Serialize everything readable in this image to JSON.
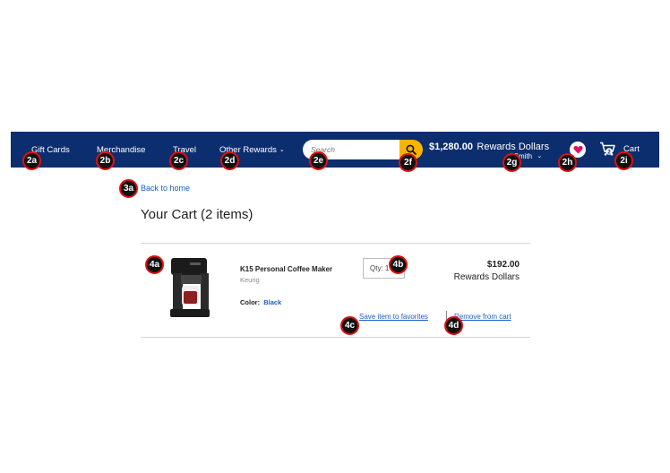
{
  "nav": {
    "items": [
      {
        "label": "Gift Cards"
      },
      {
        "label": "Merchandise"
      },
      {
        "label": "Travel"
      },
      {
        "label": "Other Rewards"
      }
    ],
    "search_placeholder": "Search",
    "rewards_amount": "$1,280.00",
    "rewards_label": "Rewards Dollars",
    "user_name": "d Smith",
    "cart_label": "Cart",
    "cart_count": "2"
  },
  "content": {
    "back_link": "Back to home",
    "title": "Your Cart (2 items)"
  },
  "cart_item": {
    "name": "K15 Personal Coffee Maker",
    "brand": "Keurig",
    "color_label": "Color:",
    "color_value": "Black",
    "qty_label": "Qty:",
    "qty_value": "1",
    "price": "$192.00",
    "price_unit": "Rewards Dollars",
    "save_link": "Save item to favorites",
    "remove_link": "Remove from cart"
  },
  "markers": {
    "m2a": "2a",
    "m2b": "2b",
    "m2c": "2c",
    "m2d": "2d",
    "m2e": "2e",
    "m2f": "2f",
    "m2g": "2g",
    "m2h": "2h",
    "m2i": "2i",
    "m3a": "3a",
    "m4a": "4a",
    "m4b": "4b",
    "m4c": "4c",
    "m4d": "4d"
  },
  "colors": {
    "nav_bg": "#0d2e6e",
    "search_button": "#f4b400",
    "link": "#1a5fc4",
    "favorite": "#e0115f",
    "marker_border": "#e01010"
  }
}
